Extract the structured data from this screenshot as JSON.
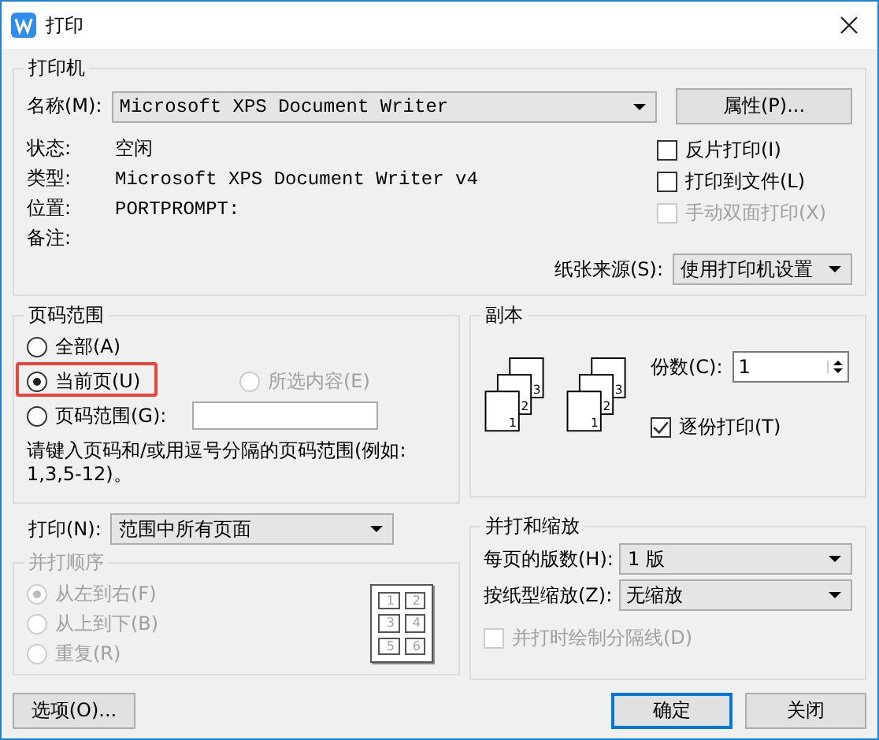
{
  "window": {
    "title": "打印"
  },
  "printer": {
    "title": "打印机",
    "name_label": "名称(M):",
    "name_value": "Microsoft XPS Document Writer",
    "properties_button": "属性(P)...",
    "info": [
      {
        "label": "状态:",
        "value": "空闲"
      },
      {
        "label": "类型:",
        "value": "Microsoft XPS Document Writer v4",
        "mono": true
      },
      {
        "label": "位置:",
        "value": "PORTPROMPT:",
        "mono": true
      },
      {
        "label": "备注:"
      }
    ],
    "options": [
      {
        "label": "反片打印(I)",
        "checked": false,
        "disabled": false
      },
      {
        "label": "打印到文件(L)",
        "checked": false,
        "disabled": false
      },
      {
        "label": "手动双面打印(X)",
        "checked": false,
        "disabled": true
      }
    ],
    "paper_source": {
      "label": "纸张来源(S):",
      "value": "使用打印机设置"
    }
  },
  "page_range": {
    "title": "页码范围",
    "options": [
      {
        "label": "全部(A)",
        "selected": false,
        "disabled": false,
        "highlighted": false
      },
      {
        "label": "当前页(U)",
        "selected": true,
        "disabled": false,
        "highlighted": true
      },
      {
        "label": "所选内容(E)",
        "selected": false,
        "disabled": true,
        "highlighted": false
      },
      {
        "label": "页码范围(G):",
        "selected": false,
        "disabled": false,
        "highlighted": false
      }
    ],
    "hint": "请键入页码和/或用逗号分隔的页码范围(例如:1,3,5-12)。"
  },
  "copies": {
    "title": "副本",
    "illustrations": [
      [
        "1",
        "2",
        "3"
      ],
      [
        "1",
        "2",
        "3"
      ]
    ],
    "count_label": "份数(C):",
    "count_value": "1",
    "collate": {
      "label": "逐份打印(T)",
      "checked": true
    }
  },
  "print_what": {
    "label": "打印(N):",
    "value": "范围中所有页面"
  },
  "order": {
    "title": "并打顺序",
    "disabled": true,
    "options": [
      {
        "label": "从左到右(F)",
        "selected": true
      },
      {
        "label": "从上到下(B)",
        "selected": false
      },
      {
        "label": "重复(R)",
        "selected": false
      }
    ],
    "illustration": [
      "1",
      "2",
      "3",
      "4",
      "5",
      "6"
    ]
  },
  "zoom": {
    "title": "并打和缩放",
    "pages_per_sheet": {
      "label": "每页的版数(H):",
      "value": "1 版"
    },
    "scale": {
      "label": "按纸型缩放(Z):",
      "value": "无缩放"
    },
    "draw_lines": {
      "label": "并打时绘制分隔线(D)",
      "checked": false,
      "disabled": true
    }
  },
  "buttons": {
    "options": "选项(O)...",
    "ok": "确定",
    "close": "关闭"
  }
}
